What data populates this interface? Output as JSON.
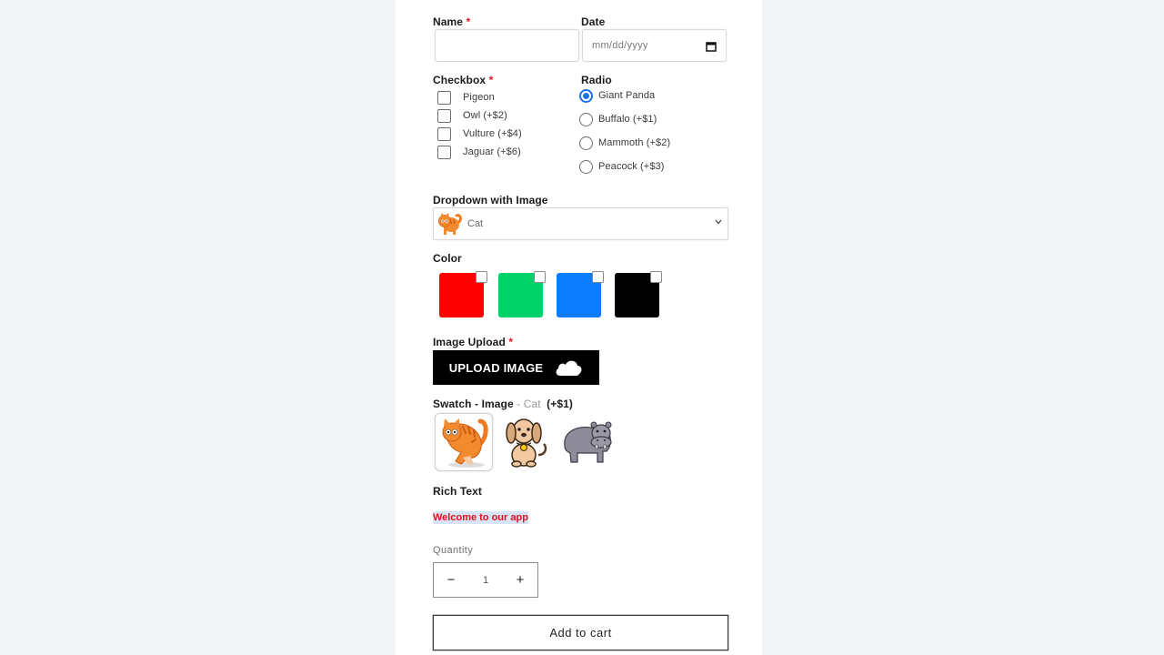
{
  "form": {
    "name": {
      "label": "Name",
      "required_mark": "*",
      "value": ""
    },
    "date": {
      "label": "Date",
      "placeholder": "mm/dd/yyyy",
      "icon": "calendar-icon"
    },
    "checkbox": {
      "label": "Checkbox",
      "required_mark": "*",
      "options": [
        {
          "label": "Pigeon",
          "checked": false
        },
        {
          "label": "Owl (+$2)",
          "checked": false
        },
        {
          "label": "Vulture (+$4)",
          "checked": false
        },
        {
          "label": "Jaguar (+$6)",
          "checked": false
        }
      ]
    },
    "radio": {
      "label": "Radio",
      "options": [
        {
          "label": "Giant Panda",
          "checked": true
        },
        {
          "label": "Buffalo (+$1)",
          "checked": false
        },
        {
          "label": "Mammoth (+$2)",
          "checked": false
        },
        {
          "label": "Peacock (+$3)",
          "checked": false
        }
      ]
    },
    "dropdown": {
      "label": "Dropdown with Image",
      "selected": "Cat",
      "icon": "cat-icon"
    },
    "color": {
      "label": "Color",
      "swatches": [
        {
          "name": "red",
          "hex": "#ff0000",
          "checked": false
        },
        {
          "name": "green",
          "hex": "#00d26a",
          "checked": false
        },
        {
          "name": "blue",
          "hex": "#0a7cff",
          "checked": false
        },
        {
          "name": "black",
          "hex": "#000000",
          "checked": false
        }
      ]
    },
    "upload": {
      "label": "Image Upload",
      "required_mark": "*",
      "button_label": "UPLOAD IMAGE",
      "icon": "cloud-icon"
    },
    "swatch_image": {
      "label": "Swatch - Image",
      "separator": " - ",
      "selected": "Cat",
      "price": "(+$1)",
      "options": [
        {
          "name": "Cat",
          "selected": true
        },
        {
          "name": "Dog",
          "selected": false
        },
        {
          "name": "Hippo",
          "selected": false
        }
      ]
    },
    "rich_text": {
      "label": "Rich Text",
      "content": "Welcome to our app"
    },
    "quantity": {
      "label": "Quantity",
      "value": "1",
      "minus": "−",
      "plus": "+"
    },
    "add_to_cart": "Add to cart"
  },
  "colors": {
    "required": "#e0141e",
    "radio_accent": "#1a73e8",
    "rich_text_highlight": "#d6e4f5"
  }
}
